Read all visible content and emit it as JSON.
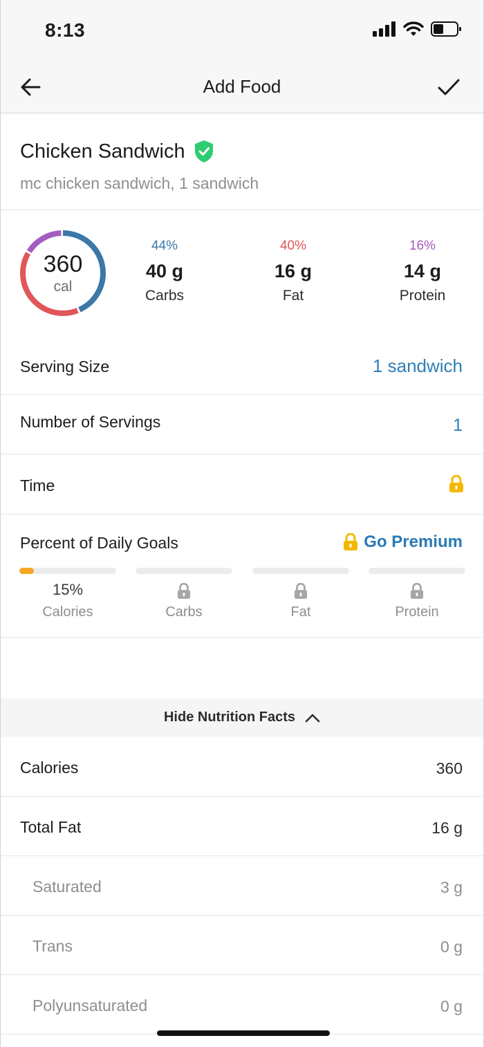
{
  "status_bar": {
    "time": "8:13"
  },
  "nav": {
    "title": "Add Food"
  },
  "food": {
    "name": "Chicken Sandwich",
    "description": "mc chicken sandwich, 1 sandwich"
  },
  "calories": {
    "value": "360",
    "unit": "cal"
  },
  "macros": [
    {
      "pct": "44%",
      "grams": "40 g",
      "label": "Carbs",
      "color": "#3b78a8"
    },
    {
      "pct": "40%",
      "grams": "16 g",
      "label": "Fat",
      "color": "#e05659"
    },
    {
      "pct": "16%",
      "grams": "14 g",
      "label": "Protein",
      "color": "#a45cc0"
    }
  ],
  "serving": {
    "size_label": "Serving Size",
    "size_value": "1 sandwich",
    "count_label": "Number of Servings",
    "count_value": "1",
    "time_label": "Time"
  },
  "goals": {
    "title": "Percent of Daily Goals",
    "premium_label": "Go Premium",
    "items": [
      {
        "label": "Calories",
        "value": "15%",
        "fill_fraction": 0.15,
        "locked": false
      },
      {
        "label": "Carbs",
        "locked": true
      },
      {
        "label": "Fat",
        "locked": true
      },
      {
        "label": "Protein",
        "locked": true
      }
    ]
  },
  "nutrition_toggle": {
    "label": "Hide Nutrition Facts"
  },
  "nutrition": [
    {
      "label": "Calories",
      "value": "360",
      "sub": false
    },
    {
      "label": "Total Fat",
      "value": "16 g",
      "sub": false
    },
    {
      "label": "Saturated",
      "value": "3 g",
      "sub": true
    },
    {
      "label": "Trans",
      "value": "0 g",
      "sub": true
    },
    {
      "label": "Polyunsaturated",
      "value": "0 g",
      "sub": true
    }
  ],
  "colors": {
    "accent_blue": "#2f7fb8",
    "verified_green": "#2ecc71",
    "lock_yellow": "#f5b800",
    "goal_fill": "#f5a623"
  }
}
